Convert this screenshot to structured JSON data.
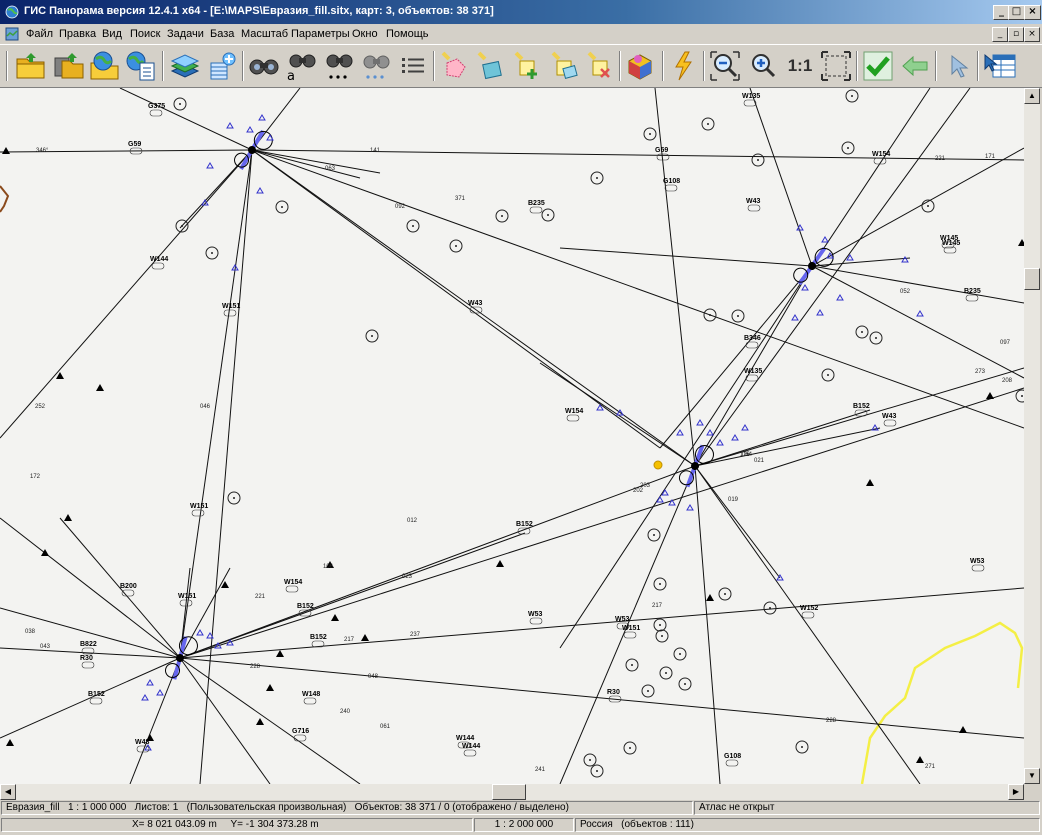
{
  "window": {
    "title": "ГИС Панорама версия 12.4.1 x64 - [E:\\MAPS\\Евразия_fill.sitx, карт: 3, объектов: 38 371]",
    "controls": [
      "_",
      "□",
      "×"
    ]
  },
  "menu": {
    "items": [
      "Файл",
      "Правка",
      "Вид",
      "Поиск",
      "Задачи",
      "База",
      "Масштаб",
      "Параметры",
      "Окно",
      "Помощь"
    ],
    "mdi_controls": [
      "_",
      "▫",
      "×"
    ]
  },
  "toolbar": {
    "scale_1to1_label": "1:1",
    "icons": [
      "open-folder-icon",
      "open-multiple-icon",
      "open-web-icon",
      "open-document-icon",
      "layers-icon",
      "load-data-icon",
      "binoculars-icon",
      "binoculars-text-icon",
      "binoculars-dots-icon",
      "binoculars-grey-icon",
      "list-icon",
      "select-object-icon",
      "select-area-icon",
      "add-object-icon",
      "edit-object-icon",
      "delete-object-icon",
      "3d-view-icon",
      "lightning-icon",
      "zoom-out-icon",
      "zoom-in-icon",
      "fit-to-window-icon",
      "apply-check-icon",
      "back-arrow-icon",
      "pointer-icon",
      "table-select-icon"
    ]
  },
  "map": {
    "colors": {
      "background": "#f3f3f1",
      "route": "#000000",
      "navaid": "#3333cc",
      "runway": "#6666ee",
      "border": "#f4ef45",
      "highlight": "#f5c000",
      "coast": "#8b4a1c"
    },
    "route_labels": [
      "G375",
      "G59",
      "B235",
      "W145",
      "B235",
      "W154",
      "G59",
      "G108",
      "W43",
      "W144",
      "W151",
      "W154",
      "B152",
      "W43",
      "B346",
      "W135",
      "B152",
      "W53",
      "W152",
      "W151",
      "B200",
      "W154",
      "B152",
      "W53",
      "B152",
      "B822",
      "R30",
      "B152",
      "W151",
      "W148",
      "G716",
      "W144",
      "W53",
      "W145",
      "R30",
      "G108",
      "W48",
      "W135",
      "W43",
      "W151",
      "W144"
    ],
    "segment_labels": [
      "346°",
      "141",
      "221",
      "171",
      "063",
      "092",
      "371",
      "052",
      "097",
      "046",
      "252",
      "273",
      "172",
      "221",
      "064",
      "203",
      "126",
      "021",
      "019",
      "202",
      "217",
      "237",
      "217",
      "043",
      "048",
      "038",
      "228",
      "240",
      "061",
      "241",
      "208",
      "271",
      "228",
      "012",
      "023",
      "106"
    ]
  },
  "status": {
    "map_name": "Евразия_fill",
    "scale": "1 : 1 000 000",
    "sheets": "Листов: 1",
    "projection": "(Пользовательская произвольная)",
    "objects": "Объектов: 38 371 / 0 (отображено / выделено)",
    "atlas": "Атлас не открыт",
    "x": "X= 8 021 043.09 m",
    "y": "Y= -1 304 373.28 m",
    "view_scale": "1 : 2 000 000",
    "region": "Россия",
    "region_objects": "(объектов : 111)"
  }
}
